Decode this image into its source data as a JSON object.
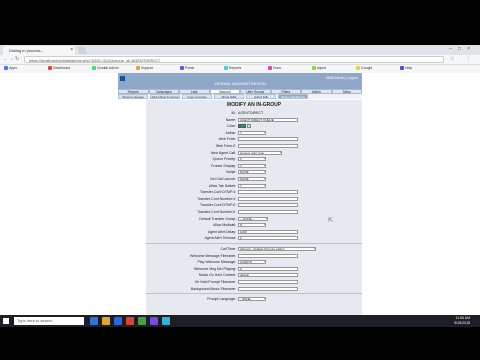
{
  "browser": {
    "tab_title": "Dialing in process...",
    "url": "https://localhost/vicidial/admin.php?ADD=3111&group_id=AGENTDIRECT",
    "bookmarks": [
      "Apps",
      "Dashboard",
      "Vicidial Admin",
      "Support",
      "Portal",
      "Reports",
      "Docs",
      "Agent",
      "Google",
      "Help"
    ]
  },
  "app": {
    "header_title": "VICIDIAL ADMINISTRATION",
    "user_info": "6666 Admin | Logout",
    "nav_tabs": [
      {
        "label": "Reports",
        "active": false
      },
      {
        "label": "Campaigns",
        "active": false
      },
      {
        "label": "Lists",
        "active": false
      },
      {
        "label": "Inbound",
        "active": true
      },
      {
        "label": "User Groups",
        "active": false
      },
      {
        "label": "Filters",
        "active": false
      },
      {
        "label": "Admin",
        "active": false
      },
      {
        "label": "Setup",
        "active": false
      }
    ],
    "sub_tabs": [
      {
        "label": "Show In-Groups",
        "active": false
      },
      {
        "label": "Add A New In-Group",
        "active": false
      },
      {
        "label": "Copy In-Group",
        "active": false
      },
      {
        "label": "Show DIDs",
        "active": false
      },
      {
        "label": "Add A DID",
        "active": false
      }
    ],
    "sub_tabs_2": [
      {
        "label": "Show Call Menus",
        "active": true
      }
    ]
  },
  "form": {
    "title": "MODIFY AN IN-GROUP",
    "fields": [
      {
        "label": "ID:",
        "kind": "text",
        "value": "AGENTDIRECT"
      },
      {
        "label": "Name:",
        "kind": "input",
        "value": "AGENT DIRECT QUEUE"
      },
      {
        "label": "Color:",
        "kind": "color",
        "value": "#2f8f6f"
      },
      {
        "label": "Active:",
        "kind": "select",
        "value": "Y"
      },
      {
        "label": "Web Form:",
        "kind": "input",
        "value": ""
      },
      {
        "label": "Web Form 2:",
        "kind": "input",
        "value": ""
      },
      {
        "label": "Next Agent Call:",
        "kind": "select",
        "value": "longest_wait_time"
      },
      {
        "label": "Queue Priority:",
        "kind": "select",
        "value": "0"
      },
      {
        "label": "Fronter Display:",
        "kind": "select",
        "value": "Y"
      },
      {
        "label": "Script:",
        "kind": "select",
        "value": "NONE"
      },
      {
        "label": "Get Call Launch:",
        "kind": "select",
        "value": "NONE"
      },
      {
        "label": "Allow Tab Switch:",
        "kind": "select",
        "value": "Y"
      },
      {
        "label": "Transfer-Conf DTMF 1:",
        "kind": "input",
        "value": ""
      },
      {
        "label": "Transfer-Conf Number 1:",
        "kind": "input",
        "value": ""
      },
      {
        "label": "Transfer-Conf DTMF 2:",
        "kind": "input",
        "value": ""
      },
      {
        "label": "Transfer-Conf Number 2:",
        "kind": "input",
        "value": ""
      },
      {
        "label": "Default Transfer Group:",
        "kind": "select",
        "value": "---NONE---"
      },
      {
        "label": "Allow Multicall:",
        "kind": "select",
        "value": "N"
      },
      {
        "label": "Agent Alert Delay:",
        "kind": "input",
        "value": "1000"
      },
      {
        "label": "Agent Alert Timeout:",
        "kind": "input",
        "value": "0"
      },
      {
        "label": "Call Time:",
        "kind": "select",
        "value": "24hours - default 24 hours calling"
      },
      {
        "label": "Welcome Message Filename:",
        "kind": "input",
        "value": ""
      },
      {
        "label": "Play Welcome Message:",
        "kind": "select",
        "value": "ALWAYS"
      },
      {
        "label": "Welcome Msg Min Playing:",
        "kind": "input",
        "value": "0"
      },
      {
        "label": "Music On Hold Context:",
        "kind": "input",
        "value": "default"
      },
      {
        "label": "On Hold Prompt Filename:",
        "kind": "input",
        "value": ""
      },
      {
        "label": "Background Music Filename:",
        "kind": "input",
        "value": ""
      },
      {
        "label": "Prompt Language:",
        "kind": "select",
        "value": "- NONE -"
      }
    ]
  },
  "taskbar": {
    "search_placeholder": "Type here to search",
    "time": "11:56 AM",
    "date": "5/15/2018"
  },
  "colors": {
    "header": "#8fa7c8",
    "taskbar": "#1c1f26",
    "panel": "#e6e9f0"
  }
}
